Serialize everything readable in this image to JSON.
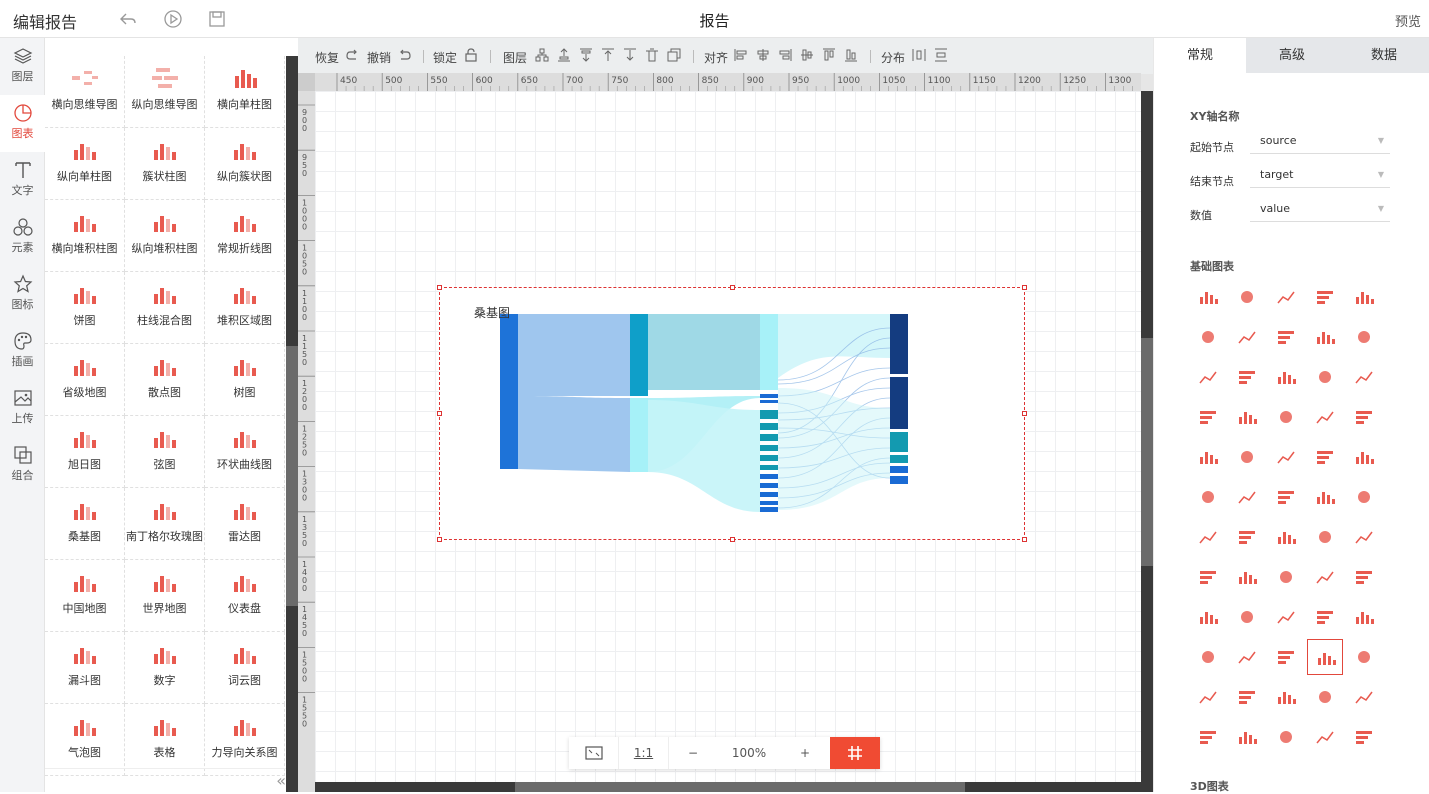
{
  "header": {
    "title": "编辑报告",
    "center_title": "报告",
    "preview": "预览"
  },
  "iconbar": [
    {
      "label": "图层",
      "icon": "layers-icon"
    },
    {
      "label": "图表",
      "icon": "chart-pie-icon",
      "active": true
    },
    {
      "label": "文字",
      "icon": "text-icon"
    },
    {
      "label": "元素",
      "icon": "shapes-icon"
    },
    {
      "label": "图标",
      "icon": "star-icon"
    },
    {
      "label": "插画",
      "icon": "palette-icon"
    },
    {
      "label": "上传",
      "icon": "image-upload-icon"
    },
    {
      "label": "组合",
      "icon": "group-icon"
    }
  ],
  "chart_items": [
    "横向思维导图",
    "纵向思维导图",
    "横向单柱图",
    "纵向单柱图",
    "簇状柱图",
    "纵向簇状图",
    "横向堆积柱图",
    "纵向堆积柱图",
    "常规折线图",
    "饼图",
    "柱线混合图",
    "堆积区域图",
    "省级地图",
    "散点图",
    "树图",
    "旭日图",
    "弦图",
    "环状曲线图",
    "桑基图",
    "南丁格尔玫瑰图",
    "雷达图",
    "中国地图",
    "世界地图",
    "仪表盘",
    "漏斗图",
    "数字",
    "词云图",
    "气泡图",
    "表格",
    "力导向关系图"
  ],
  "toolbar": {
    "redo": "恢复",
    "undo": "撤销",
    "lock": "锁定",
    "layer": "图层",
    "align": "对齐",
    "distribute": "分布"
  },
  "ruler": {
    "top": [
      "450",
      "500",
      "550",
      "600",
      "650",
      "700",
      "750",
      "800",
      "850",
      "900",
      "950",
      "1000",
      "1050",
      "1100",
      "1150",
      "1200",
      "1250",
      "1300"
    ],
    "left": [
      "900",
      "950",
      "1000",
      "1050",
      "1100",
      "1150",
      "1200",
      "1250",
      "1300",
      "1350",
      "1400",
      "1450",
      "1500",
      "1550"
    ]
  },
  "widget": {
    "title": "桑基图"
  },
  "zoom": {
    "fit": "⛶",
    "one_to_one": "1:1",
    "minus": "−",
    "value": "100%",
    "plus": "+"
  },
  "right_panel": {
    "tabs": [
      "常规",
      "高级",
      "数据"
    ],
    "active_tab": 0,
    "xy_section": "XY轴名称",
    "fields": [
      {
        "label": "起始节点",
        "value": "source"
      },
      {
        "label": "结束节点",
        "value": "target"
      },
      {
        "label": "数值",
        "value": "value"
      }
    ],
    "basic_section": "基础图表",
    "section_3d": "3D图表"
  },
  "colors": {
    "accent": "#e2483c",
    "zoom_grid": "#f04b33"
  }
}
